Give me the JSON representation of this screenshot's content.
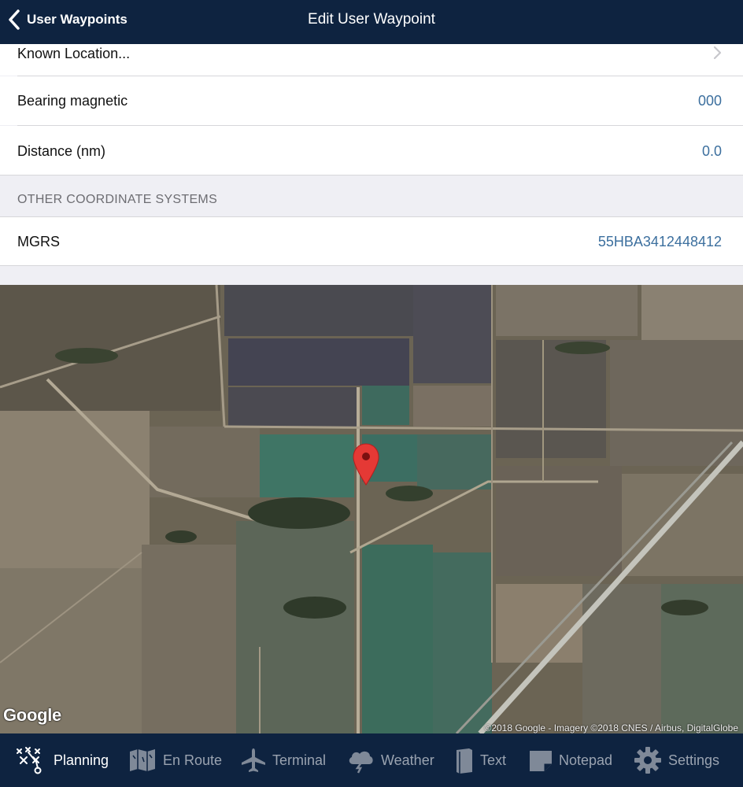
{
  "navbar": {
    "back_label": "User Waypoints",
    "title": "Edit User Waypoint"
  },
  "rows": {
    "known_location": {
      "label": "Known Location..."
    },
    "bearing": {
      "label": "Bearing magnetic",
      "value": "000"
    },
    "distance": {
      "label": "Distance (nm)",
      "value": "0.0"
    }
  },
  "section": {
    "header": "OTHER COORDINATE SYSTEMS"
  },
  "mgrs": {
    "label": "MGRS",
    "value": "55HBA3412448412"
  },
  "map": {
    "logo": "Google",
    "attribution": "©2018 Google - Imagery ©2018 CNES / Airbus, DigitalGlobe"
  },
  "tabs": [
    {
      "label": "Planning",
      "icon": "planning-icon",
      "active": true
    },
    {
      "label": "En Route",
      "icon": "map-icon",
      "active": false
    },
    {
      "label": "Terminal",
      "icon": "airplane-icon",
      "active": false
    },
    {
      "label": "Weather",
      "icon": "weather-icon",
      "active": false
    },
    {
      "label": "Text",
      "icon": "book-icon",
      "active": false
    },
    {
      "label": "Notepad",
      "icon": "notepad-icon",
      "active": false
    },
    {
      "label": "Settings",
      "icon": "gear-icon",
      "active": false
    }
  ],
  "colors": {
    "nav_bg": "#0e2340",
    "value_blue": "#3c6f9e",
    "pin_red": "#e53935"
  }
}
